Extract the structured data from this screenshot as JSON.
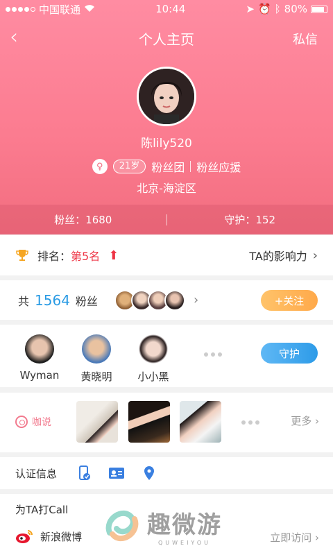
{
  "status_bar": {
    "carrier": "中国联通",
    "time": "10:44",
    "battery": "80%"
  },
  "nav": {
    "back_icon": "chevron-left-icon",
    "title": "个人主页",
    "message_label": "私信"
  },
  "profile": {
    "username": "陈lily520",
    "age_badge": "21岁",
    "fan_group": "粉丝团",
    "fan_support": "粉丝应援",
    "location": "北京-海淀区"
  },
  "stats": {
    "fans": "粉丝：1680",
    "guard": "守护：152"
  },
  "rank": {
    "label": "排名：",
    "value": "第5名",
    "influence": "TA的影响力"
  },
  "fans_row": {
    "prefix": "共",
    "count": "1564",
    "suffix": "粉丝",
    "follow_label": "+关注"
  },
  "guards": {
    "users": [
      {
        "name": "Wyman"
      },
      {
        "name": "黄晓明"
      },
      {
        "name": "小小黑"
      }
    ],
    "button_label": "守护"
  },
  "posts": {
    "label": "咖说",
    "more": "更多"
  },
  "verify": {
    "label": "认证信息"
  },
  "call": {
    "title": "为TA打Call",
    "weibo": "新浪微博",
    "visit": "立即访问"
  },
  "watermark": {
    "text": "趣微游",
    "sub": "QUWEIYOU"
  },
  "colors": {
    "header_pink": "#fb7b8f",
    "rank_red": "#ee3344",
    "count_blue": "#2a9be4",
    "follow_orange": "#ffa94a",
    "guard_blue": "#2d9be8"
  }
}
